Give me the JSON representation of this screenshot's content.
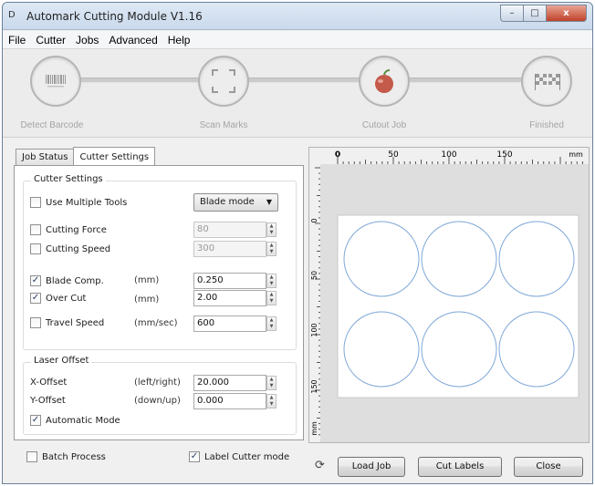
{
  "window": {
    "title": "Automark Cutting Module V1.16",
    "controls": {
      "minimize": "–",
      "maximize": "□",
      "close": "x"
    }
  },
  "menu": [
    "File",
    "Cutter",
    "Jobs",
    "Advanced",
    "Help"
  ],
  "steps": [
    {
      "label": "Detect Barcode",
      "icon": "barcode-icon"
    },
    {
      "label": "Scan Marks",
      "icon": "scan-marks-icon"
    },
    {
      "label": "Cutout Job",
      "icon": "apple-icon"
    },
    {
      "label": "Finished",
      "icon": "checkered-flags-icon"
    }
  ],
  "tabs": {
    "job_status": "Job Status",
    "cutter_settings": "Cutter Settings"
  },
  "cutter_settings": {
    "group_title": "Cutter Settings",
    "use_multiple_tools": {
      "label": "Use Multiple Tools",
      "checked": false
    },
    "mode_select": "Blade mode",
    "cutting_force": {
      "label": "Cutting Force",
      "value": "80",
      "checked": false
    },
    "cutting_speed": {
      "label": "Cutting Speed",
      "value": "300",
      "checked": false
    },
    "blade_comp": {
      "label": "Blade Comp.",
      "unit": "(mm)",
      "value": "0.250",
      "checked": true
    },
    "over_cut": {
      "label": "Over Cut",
      "unit": "(mm)",
      "value": "2.00",
      "checked": true
    },
    "travel_speed": {
      "label": "Travel Speed",
      "unit": "(mm/sec)",
      "value": "600",
      "checked": false
    }
  },
  "laser_offset": {
    "group_title": "Laser Offset",
    "x_offset": {
      "label": "X-Offset",
      "unit": "(left/right)",
      "value": "20.000"
    },
    "y_offset": {
      "label": "Y-Offset",
      "unit": "(down/up)",
      "value": "0.000"
    },
    "automatic_mode": {
      "label": "Automatic Mode",
      "checked": true
    }
  },
  "options": {
    "batch_process": {
      "label": "Batch Process",
      "checked": false
    },
    "label_cutter_mode": {
      "label": "Label Cutter mode",
      "checked": true
    }
  },
  "preview": {
    "top_ruler": [
      "0",
      "50",
      "100",
      "150",
      "mm"
    ],
    "left_ruler": [
      "0",
      "50",
      "100",
      "150",
      "mm"
    ],
    "circle_count": 6
  },
  "buttons": {
    "load_job": "Load Job",
    "cut_labels": "Cut Labels",
    "close": "Close"
  },
  "colors": {
    "circle": "#7fa8d8",
    "sheet": "#ffffff",
    "preview_bg": "#dedede"
  }
}
